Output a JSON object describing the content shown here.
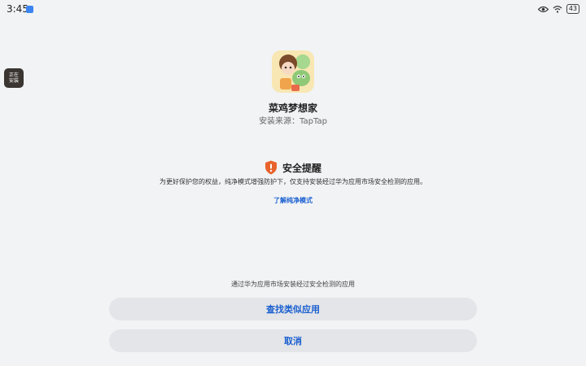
{
  "status_bar": {
    "time": "3:45",
    "battery": "43",
    "icons": [
      "notification-icon",
      "eye-icon",
      "wifi-icon",
      "battery-icon"
    ]
  },
  "floating_badge": {
    "line1": "正在",
    "line2": "安装"
  },
  "app": {
    "name": "菜鸡梦想家",
    "install_source": "安装来源：TapTap"
  },
  "warning": {
    "title": "安全提醒",
    "description": "为更好保护您的权益，纯净模式增强防护下，仅支持安装经过华为应用市场安全检测的应用。",
    "link": "了解纯净模式",
    "icon_color": "#e8632b"
  },
  "footer": {
    "hint": "通过华为应用市场安装经过安全检测的应用",
    "find_button": "查找类似应用",
    "cancel_button": "取消"
  },
  "colors": {
    "accent": "#1a5fd0",
    "background": "#f1f3f5",
    "button_bg": "#e3e5e8"
  }
}
